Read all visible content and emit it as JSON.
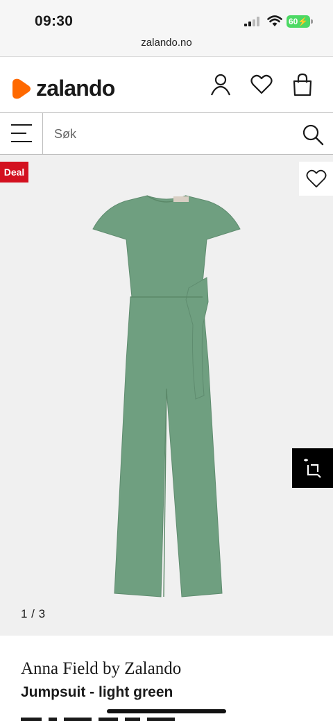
{
  "status_bar": {
    "time": "09:30",
    "url": "zalando.no",
    "battery": "60"
  },
  "header": {
    "logo_text": "zalando",
    "brand_color": "#ff6900",
    "icons": [
      "user-icon",
      "heart-icon",
      "shopping-bag-icon"
    ]
  },
  "search": {
    "placeholder": "Søk",
    "icons": [
      "menu-icon",
      "search-icon"
    ]
  },
  "gallery": {
    "badge": "Deal",
    "badge_color": "#d3101f",
    "counter": "1 / 3",
    "product_color": "#6f9f80",
    "icons": [
      "heart-icon",
      "compare-icon"
    ]
  },
  "product": {
    "brand": "Anna Field by Zalando",
    "name": "Jumpsuit - light green"
  }
}
